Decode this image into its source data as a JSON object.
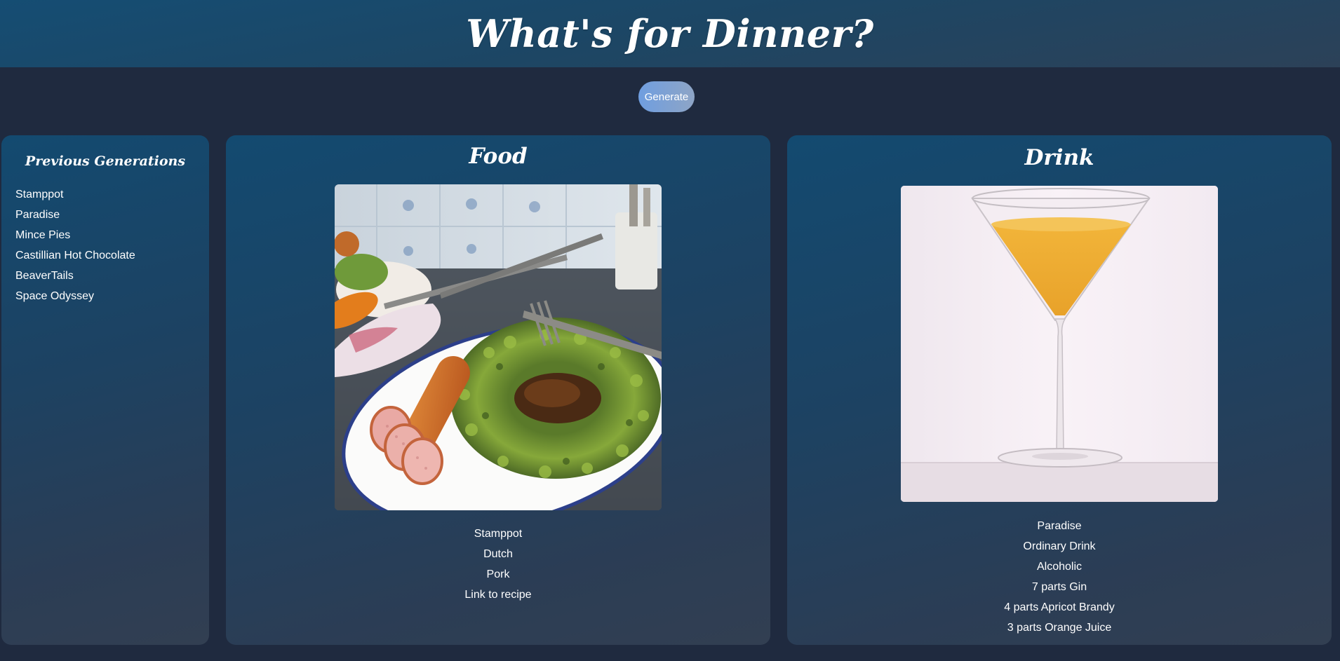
{
  "header": {
    "title": "What's for Dinner?"
  },
  "controls": {
    "generate_label": "Generate"
  },
  "history": {
    "title": "Previous Generations",
    "items": [
      "Stamppot",
      "Paradise",
      "Mince Pies",
      "Castillian Hot Chocolate",
      "BeaverTails",
      "Space Odyssey"
    ]
  },
  "food": {
    "title": "Food",
    "name": "Stamppot",
    "cuisine": "Dutch",
    "category": "Pork",
    "link_label": "Link to recipe"
  },
  "drink": {
    "title": "Drink",
    "name": "Paradise",
    "category": "Ordinary Drink",
    "type": "Alcoholic",
    "ingredients": [
      "7 parts Gin",
      "4 parts Apricot Brandy",
      "3 parts Orange Juice"
    ]
  },
  "colors": {
    "background": "#1f2a3f",
    "panel": "#1d4262",
    "header": "#154d73",
    "button": "#6f9ee0"
  }
}
